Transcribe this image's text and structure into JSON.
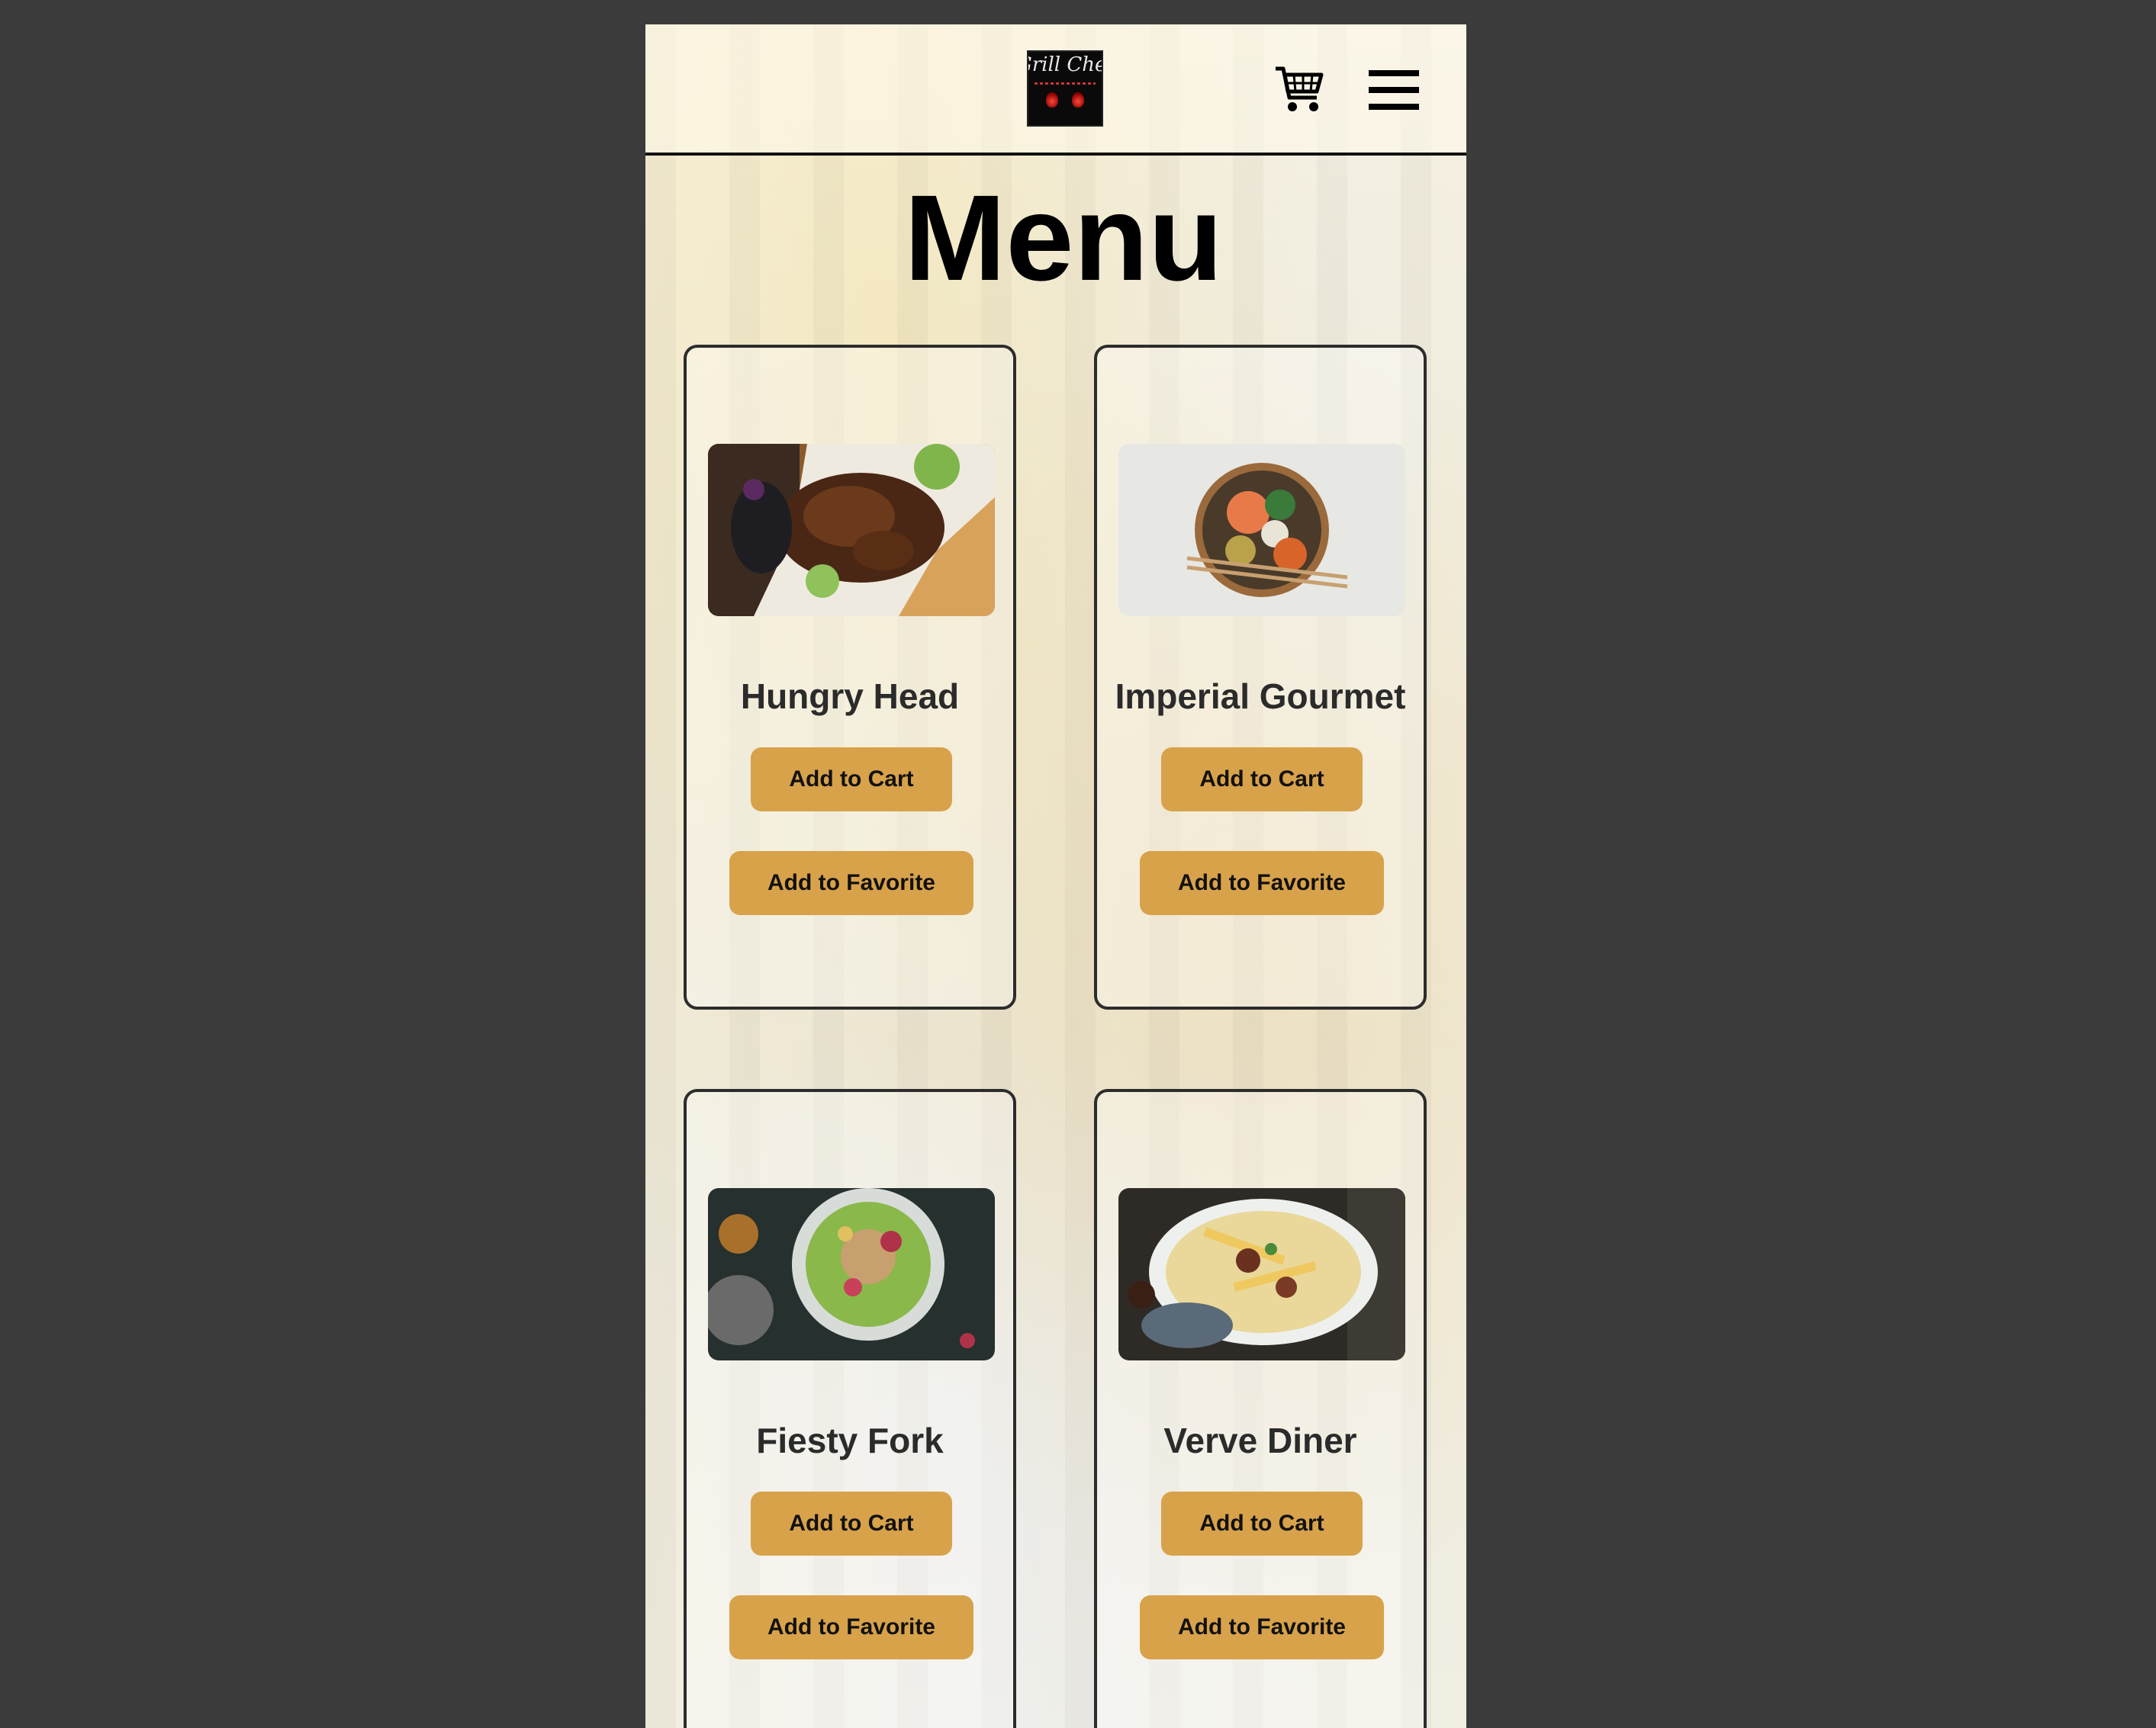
{
  "header": {
    "logo": {
      "brand_text": "Grill Chef",
      "icon_name": "grill-chef-logo"
    },
    "cart_icon": "cart-icon",
    "menu_icon": "hamburger-menu-icon"
  },
  "page": {
    "title": "Menu"
  },
  "colors": {
    "accent_button": "#d8a24a",
    "outer_background": "#3b3b3b",
    "card_border": "#2c2c2c"
  },
  "menu_items": [
    {
      "name": "Hungry Head",
      "cart_label": "Add to Cart",
      "favorite_label": "Add to Favorite",
      "image": "grilled-meat-plate-photo"
    },
    {
      "name": "Imperial Gourmet",
      "cart_label": "Add to Cart",
      "favorite_label": "Add to Favorite",
      "image": "salmon-poke-bowl-photo"
    },
    {
      "name": "Fiesty Fork",
      "cart_label": "Add to Cart",
      "favorite_label": "Add to Favorite",
      "image": "green-salad-plate-photo"
    },
    {
      "name": "Verve Diner",
      "cart_label": "Add to Cart",
      "favorite_label": "Add to Favorite",
      "image": "loaded-fries-platter-photo"
    }
  ]
}
